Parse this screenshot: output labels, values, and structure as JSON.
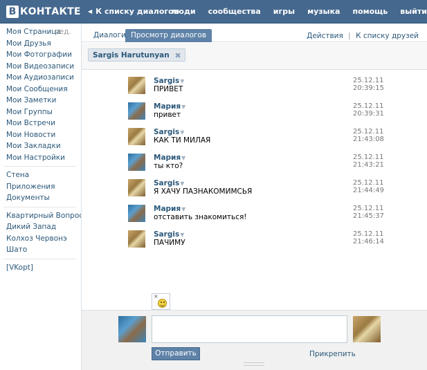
{
  "header": {
    "logo_mark": "В",
    "logo_text": "КОНТАКТЕ",
    "back_arrow": "◀",
    "back_label": "К списку диалогов",
    "nav": [
      "люди",
      "сообщества",
      "игры",
      "музыка",
      "помощь",
      "выйти"
    ]
  },
  "sidebar": {
    "edit_label": "ред.",
    "group1": [
      "Моя Страница",
      "Мои Друзья",
      "Мои Фотографии",
      "Мои Видеозаписи",
      "Мои Аудиозаписи",
      "Мои Сообщения",
      "Мои Заметки",
      "Мои Группы",
      "Мои Встречи",
      "Мои Новости",
      "Мои Закладки",
      "Мои Настройки"
    ],
    "group2": [
      "Стена",
      "Приложения",
      "Документы"
    ],
    "group3": [
      "Квартирный Вопрос",
      "Дикий Запад",
      "Колхоз Червонэ",
      "Шато"
    ],
    "group4": [
      "[VKopt]"
    ]
  },
  "tabs": {
    "dialogs": "Диалоги",
    "view": "Просмотр диалогов",
    "actions": "Действия",
    "separator": "|",
    "to_friends": "К списку друзей"
  },
  "peer": {
    "name": "Sargis Harutunyan",
    "close": "✖"
  },
  "messages": [
    {
      "author": "Sargis",
      "text": "ПРИВЕТ",
      "date": "25.12.11",
      "time": "20:39:15",
      "avatar": "sargis"
    },
    {
      "author": "Мария",
      "text": "привет",
      "date": "25.12.11",
      "time": "20:39:31",
      "avatar": "maria"
    },
    {
      "author": "Sargis",
      "text": "КАК ТИ МИЛАЯ",
      "date": "25.12.11",
      "time": "21:43:08",
      "avatar": "sargis"
    },
    {
      "author": "Мария",
      "text": "ты кто?",
      "date": "25.12.11",
      "time": "21:43:21",
      "avatar": "maria"
    },
    {
      "author": "Sargis",
      "text": "Я ХАЧУ ПАЗНАКОМИМСЬЯ",
      "date": "25.12.11",
      "time": "21:44:49",
      "avatar": "sargis"
    },
    {
      "author": "Мария",
      "text": "отставить знакомиться!",
      "date": "25.12.11",
      "time": "21:45:37",
      "avatar": "maria"
    },
    {
      "author": "Sargis",
      "text": "ПАЧИМУ",
      "date": "25.12.11",
      "time": "21:46:14",
      "avatar": "sargis"
    }
  ],
  "composer": {
    "emoji_close": "×",
    "input_value": "",
    "send_label": "Отправить",
    "attach_label": "Прикрепить"
  },
  "icons": {
    "caret": "▼",
    "emoji": "smiley-icon"
  },
  "colors": {
    "brand": "#45688e",
    "link": "#2b587a",
    "button": "#5e82a8"
  }
}
